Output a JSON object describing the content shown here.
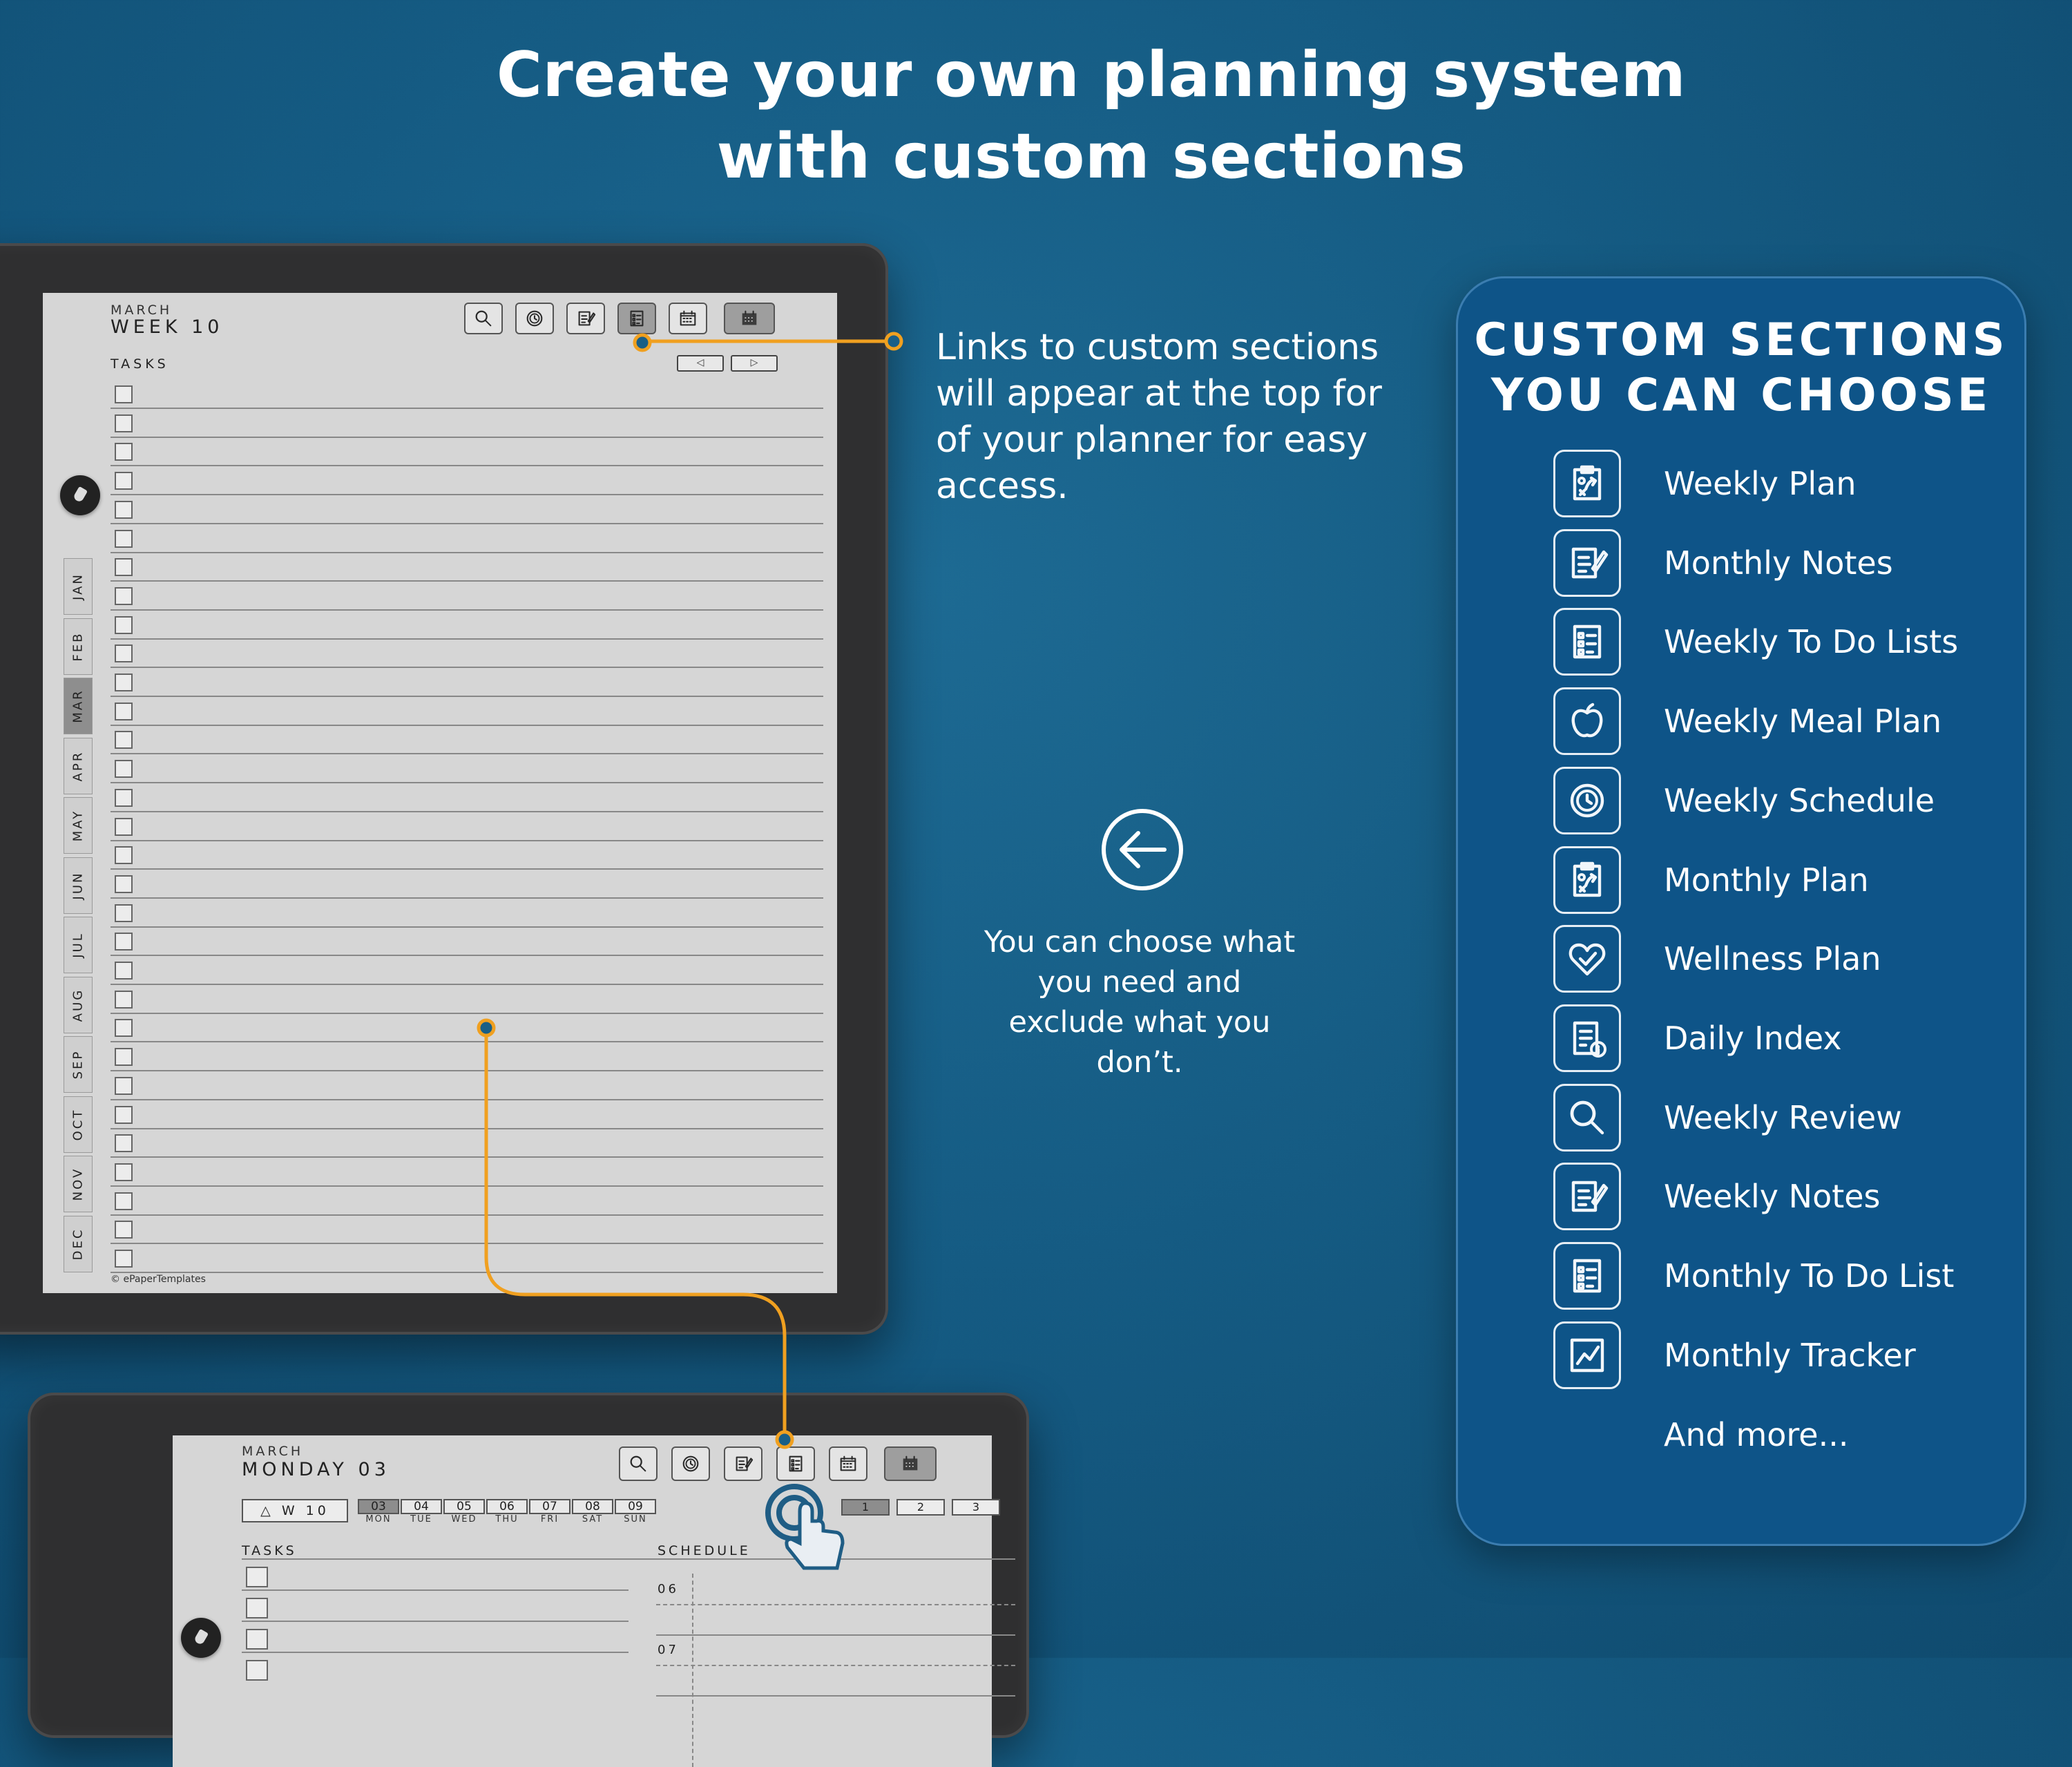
{
  "headline": {
    "line1": "Create your own planning system",
    "line2": "with custom sections"
  },
  "callout_text": "Links to custom sections will appear at the top for of your planner for easy access.",
  "choose_text": "You can choose what you need and exclude what you don’t.",
  "panel": {
    "title_line1": "CUSTOM SECTIONS",
    "title_line2": "YOU CAN CHOOSE",
    "items": [
      {
        "label": "Weekly Plan",
        "icon": "weekly-plan-icon"
      },
      {
        "label": "Monthly Notes",
        "icon": "monthly-notes-icon"
      },
      {
        "label": "Weekly To Do Lists",
        "icon": "weekly-todo-icon"
      },
      {
        "label": "Weekly Meal Plan",
        "icon": "apple-icon"
      },
      {
        "label": "Weekly  Schedule",
        "icon": "clock-icon"
      },
      {
        "label": "Monthly Plan",
        "icon": "monthly-plan-icon"
      },
      {
        "label": "Wellness Plan",
        "icon": "heart-icon"
      },
      {
        "label": "Daily Index",
        "icon": "daily-index-icon"
      },
      {
        "label": "Weekly Review",
        "icon": "magnifier-icon"
      },
      {
        "label": "Weekly Notes",
        "icon": "weekly-notes-icon"
      },
      {
        "label": "Monthly To Do List",
        "icon": "monthly-todo-icon"
      },
      {
        "label": "Monthly Tracker",
        "icon": "chart-icon"
      }
    ],
    "and_more": "And more..."
  },
  "tablet1": {
    "month": "MARCH",
    "title": "WEEK 10",
    "tasks_label": "TASKS",
    "prev_label": "◁",
    "next_label": "▷",
    "months": [
      "JAN",
      "FEB",
      "MAR",
      "APR",
      "MAY",
      "JUN",
      "JUL",
      "AUG",
      "SEP",
      "OCT",
      "NOV",
      "DEC"
    ],
    "active_month": "MAR",
    "copyright": "© ePaperTemplates",
    "toolbar_icons": [
      "search-icon",
      "clock-icon",
      "notes-icon",
      "list-icon",
      "calendar-icon",
      "month-calendar-icon"
    ]
  },
  "tablet2": {
    "month": "MARCH",
    "title": "MONDAY 03",
    "week_button": "△ W 10",
    "days": [
      {
        "num": "03",
        "name": "MON",
        "active": true
      },
      {
        "num": "04",
        "name": "TUE"
      },
      {
        "num": "05",
        "name": "WED"
      },
      {
        "num": "06",
        "name": "THU"
      },
      {
        "num": "07",
        "name": "FRI"
      },
      {
        "num": "08",
        "name": "SAT"
      },
      {
        "num": "09",
        "name": "SUN"
      }
    ],
    "tasks_label": "TASKS",
    "schedule_label": "SCHEDULE",
    "page_tabs": [
      "1",
      "2",
      "3"
    ],
    "hours": [
      "06",
      "07"
    ]
  },
  "colors": {
    "background": "#155b83",
    "panel": "#0e5488",
    "connector": "#f0a020"
  }
}
